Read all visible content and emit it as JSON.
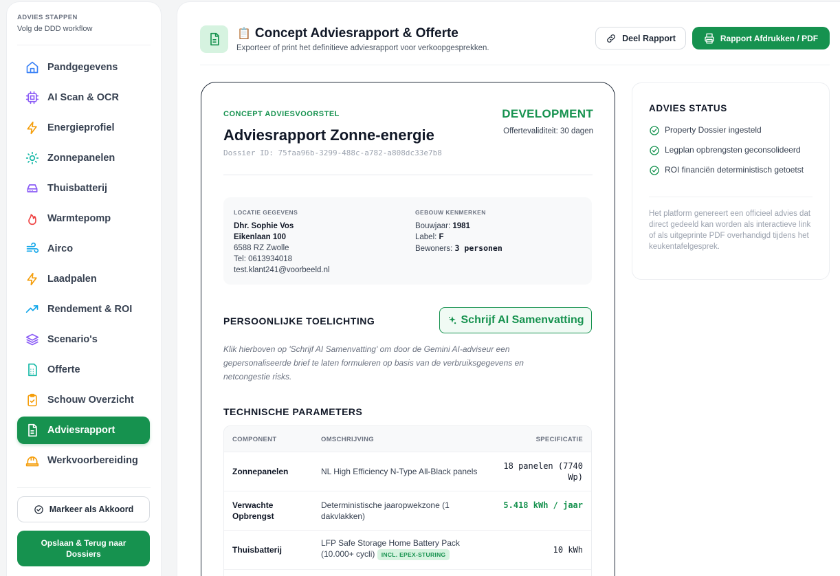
{
  "sidebar": {
    "kicker": "ADVIES STAPPEN",
    "subtitle": "Volg de DDD workflow",
    "items": [
      {
        "label": "Pandgegevens",
        "icon": "home-icon"
      },
      {
        "label": "AI Scan & OCR",
        "icon": "cpu-icon"
      },
      {
        "label": "Energieprofiel",
        "icon": "lightning-icon"
      },
      {
        "label": "Zonnepanelen",
        "icon": "sun-icon"
      },
      {
        "label": "Thuisbatterij",
        "icon": "battery-icon"
      },
      {
        "label": "Warmtepomp",
        "icon": "flame-icon"
      },
      {
        "label": "Airco",
        "icon": "wind-icon"
      },
      {
        "label": "Laadpalen",
        "icon": "lightning-icon"
      },
      {
        "label": "Rendement & ROI",
        "icon": "trending-up-icon"
      },
      {
        "label": "Scenario's",
        "icon": "layers-icon"
      },
      {
        "label": "Offerte",
        "icon": "calculator-doc-icon"
      },
      {
        "label": "Schouw Overzicht",
        "icon": "clipboard-check-icon"
      },
      {
        "label": "Adviesrapport",
        "icon": "file-text-icon",
        "active": true
      },
      {
        "label": "Werkvoorbereiding",
        "icon": "hard-hat-icon"
      }
    ],
    "akkoord_label": "Markeer als Akkoord",
    "opslaan_label": "Opslaan & Terug naar Dossiers"
  },
  "header": {
    "emoji": "📋",
    "title": "Concept Adviesrapport & Offerte",
    "subtitle": "Exporteer of print het definitieve adviesrapport voor verkoopgesprekken.",
    "share_label": "Deel Rapport",
    "print_label": "Rapport Afdrukken / PDF"
  },
  "report": {
    "kicker": "CONCEPT ADVIESVOORSTEL",
    "title": "Adviesrapport Zonne-energie",
    "dossier": "Dossier ID: 75faa96b-3299-488c-a782-a808dc33e7b8",
    "environment": "DEVELOPMENT",
    "validity": "Offertevaliditeit: 30 dagen",
    "location": {
      "label": "LOCATIE GEGEVENS",
      "name": "Dhr. Sophie Vos",
      "street": "Eikenlaan 100",
      "city": "6588 RZ Zwolle",
      "phone": "Tel: 0613934018",
      "email": "test.klant241@voorbeeld.nl"
    },
    "building": {
      "label": "GEBOUW KENMERKEN",
      "bouwjaar_key": "Bouwjaar:",
      "bouwjaar": "1981",
      "label_key": "Label:",
      "label_val": "F",
      "bewoners_key": "Bewoners:",
      "bewoners": "3 personen"
    },
    "toelichting_title": "PERSOONLIJKE TOELICHTING",
    "ai_button": "Schrijf AI Samenvatting",
    "ai_hint": "Klik hierboven op 'Schrijf AI Samenvatting' om door de Gemini AI-adviseur een gepersonaliseerde brief te laten formuleren op basis van de verbruiksgegevens en netcongestie risks.",
    "tech_title": "TECHNISCHE PARAMETERS",
    "table": {
      "headers": [
        "COMPONENT",
        "OMSCHRIJVING",
        "SPECIFICATIE"
      ],
      "rows": [
        {
          "component": "Zonnepanelen",
          "desc": "NL High Efficiency N-Type All-Black panels",
          "spec": "18 panelen (7740 Wp)"
        },
        {
          "component": "Verwachte Opbrengst",
          "desc": "Deterministische jaaropwekzone (1 dakvlakken)",
          "spec": "5.418 kWh / jaar"
        },
        {
          "component": "Thuisbatterij",
          "desc": "LFP Safe Storage Home Battery Pack (10.000+ cycli)",
          "badge": "INCL. EPEX-STURING",
          "spec": "10 kWh"
        }
      ]
    }
  },
  "status": {
    "title": "ADVIES STATUS",
    "items": [
      "Property Dossier ingesteld",
      "Legplan opbrengsten geconsolideerd",
      "ROI financiën deterministisch getoetst"
    ],
    "note": "Het platform genereert een officieel advies dat direct gedeeld kan worden als interactieve link of als uitgeprinte PDF overhandigd tijdens het keukentafelgesprek."
  },
  "colors": {
    "accent": "#16924f",
    "accent_light": "#d6f3e0"
  }
}
